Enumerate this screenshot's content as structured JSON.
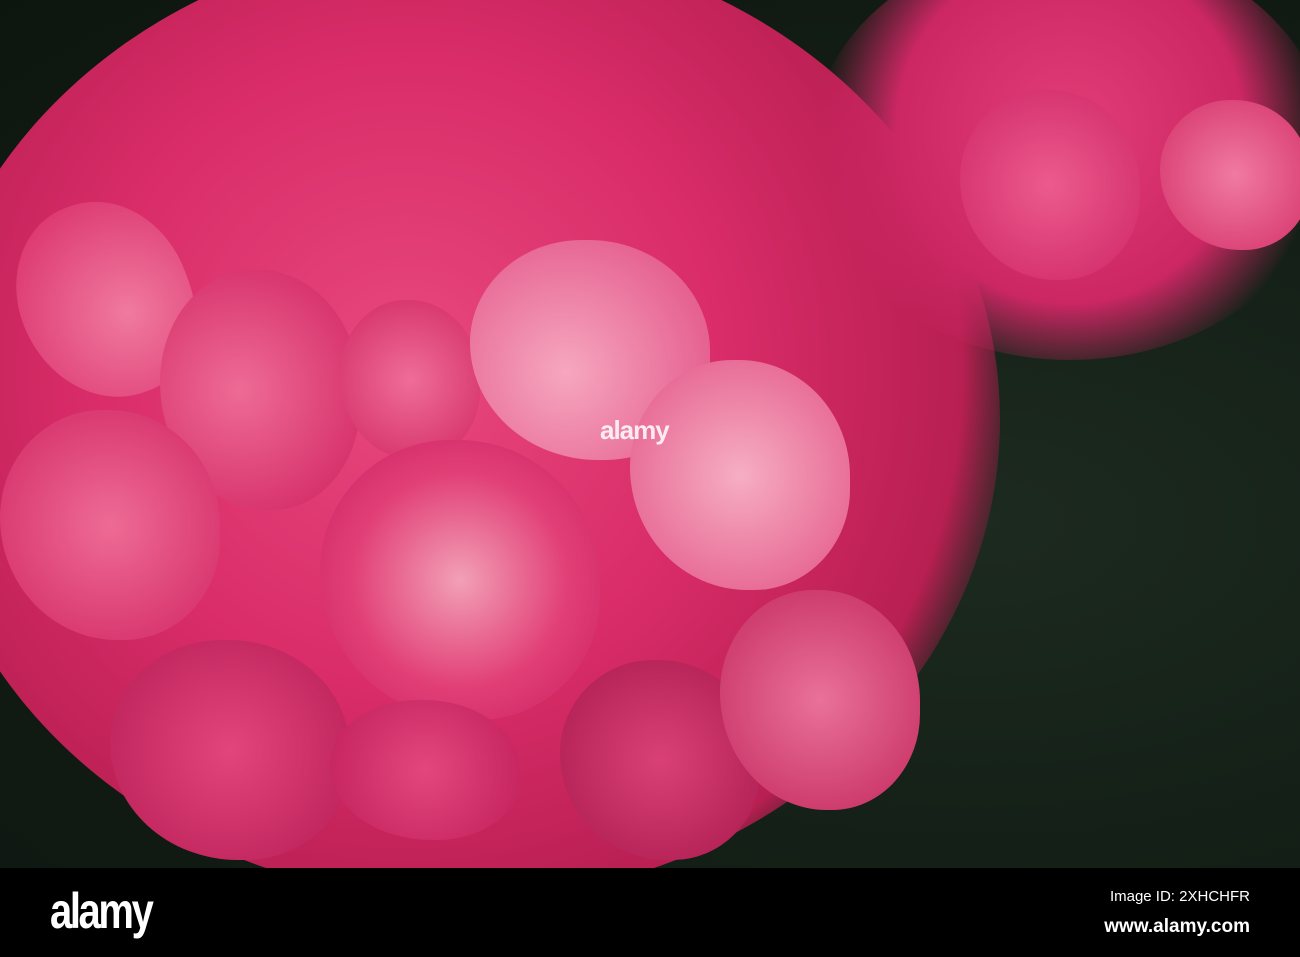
{
  "watermark": {
    "logo": "alamy",
    "overlay_text": "alamy"
  },
  "footer": {
    "logo": "alamy",
    "image_id": "Image ID: 2XHCHFR",
    "website": "www.alamy.com"
  },
  "colors": {
    "petal": "#e0306e",
    "petal_light": "#f27aa0",
    "leaf": "#142017",
    "footer": "#000000"
  }
}
